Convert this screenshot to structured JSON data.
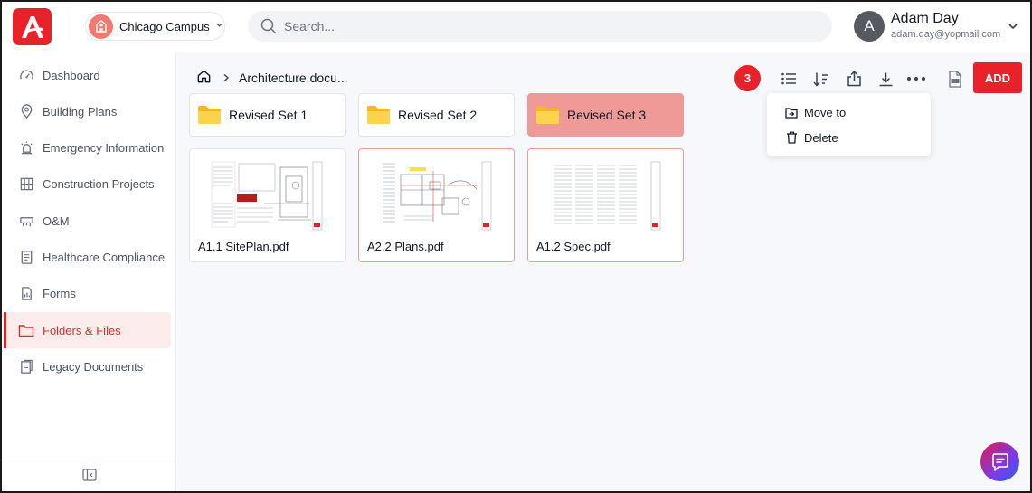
{
  "header": {
    "campus_label": "Chicago Campus",
    "search_placeholder": "Search...",
    "user_initial": "A",
    "user_name": "Adam Day",
    "user_email": "adam.day@yopmail.com"
  },
  "sidebar": {
    "items": [
      {
        "label": "Dashboard",
        "icon": "gauge-icon"
      },
      {
        "label": "Building Plans",
        "icon": "location-pin-icon"
      },
      {
        "label": "Emergency Information",
        "icon": "alarm-light-icon"
      },
      {
        "label": "Construction Projects",
        "icon": "building-icon"
      },
      {
        "label": "O&M",
        "icon": "tools-icon"
      },
      {
        "label": "Healthcare Compliance",
        "icon": "clipboard-icon"
      },
      {
        "label": "Forms",
        "icon": "form-icon"
      },
      {
        "label": "Folders & Files",
        "icon": "folder-icon",
        "active": true
      },
      {
        "label": "Legacy Documents",
        "icon": "documents-icon"
      }
    ]
  },
  "breadcrumb": {
    "current": "Architecture docu..."
  },
  "toolbar": {
    "selected_count": "3",
    "add_label": "ADD"
  },
  "context_menu": {
    "items": [
      {
        "label": "Move to",
        "icon": "move-to-icon"
      },
      {
        "label": "Delete",
        "icon": "trash-icon"
      }
    ]
  },
  "folders": [
    {
      "name": "Revised Set 1",
      "selected": false
    },
    {
      "name": "Revised Set 2",
      "selected": false
    },
    {
      "name": "Revised Set 3",
      "selected": true
    }
  ],
  "files": [
    {
      "name": "A1.1 SitePlan.pdf",
      "selected": false
    },
    {
      "name": "A2.2 Plans.pdf",
      "selected": true
    },
    {
      "name": "A1.2 Spec.pdf",
      "selected": true
    }
  ],
  "colors": {
    "brand": "#e8212a",
    "selected_folder": "#ef9a96",
    "active_nav_bg": "#fdecec",
    "folder_yellow": "#f9c624"
  }
}
